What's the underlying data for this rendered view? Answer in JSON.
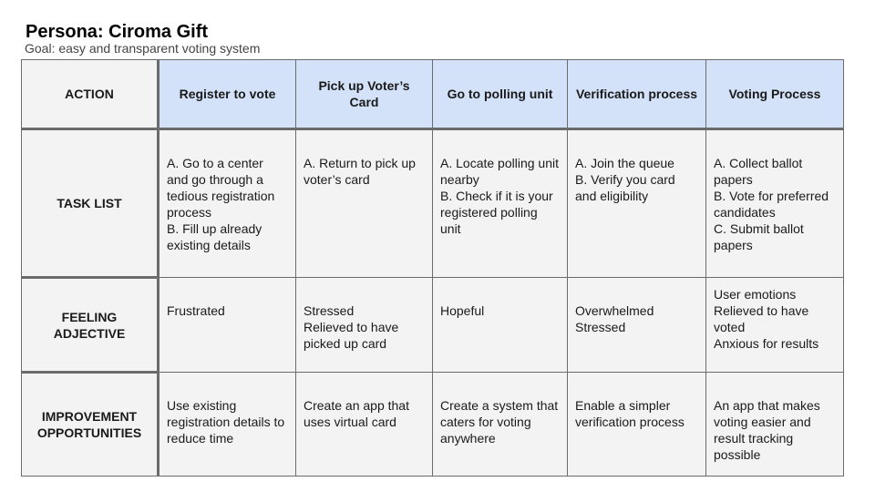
{
  "header": {
    "title": "Persona: Ciroma Gift",
    "subtitle": "Goal: easy and transparent voting system"
  },
  "table": {
    "corner_label": "ACTION",
    "columns": [
      "Register to vote",
      "Pick up Voter’s Card",
      "Go to polling unit",
      "Verification process",
      "Voting Process"
    ],
    "rows": [
      {
        "label": "TASK LIST",
        "cells": [
          [
            "A. Go to a center and go through a tedious registration process",
            "B. Fill up already existing details"
          ],
          [
            "A. Return to pick up voter’s card"
          ],
          [
            "A. Locate polling unit nearby",
            "B. Check if it is your registered polling unit"
          ],
          [
            "A. Join the queue",
            "B. Verify you card and eligibility"
          ],
          [
            "A. Collect ballot papers",
            "B.  Vote for preferred candidates",
            "C. Submit ballot papers"
          ]
        ]
      },
      {
        "label": "FEELING ADJECTIVE",
        "cells": [
          [
            "Frustrated"
          ],
          [
            "Stressed",
            "Relieved to have picked up card"
          ],
          [
            "Hopeful"
          ],
          [
            "Overwhelmed",
            "Stressed"
          ],
          [
            "User emotions",
            "Relieved to have voted",
            "Anxious for results"
          ]
        ]
      },
      {
        "label": "IMPROVEMENT OPPORTUNITIES",
        "cells": [
          [
            "Use existing registration details to reduce time"
          ],
          [
            "Create an app that uses virtual card"
          ],
          [
            "Create a system that caters for voting anywhere"
          ],
          [
            "Enable a simpler verification process"
          ],
          [
            "An app that makes voting easier and result tracking possible"
          ]
        ]
      }
    ]
  },
  "colors": {
    "header_fill": "#d3e2f8",
    "cell_fill": "#f3f3f3",
    "border": "#6b6b6b"
  }
}
